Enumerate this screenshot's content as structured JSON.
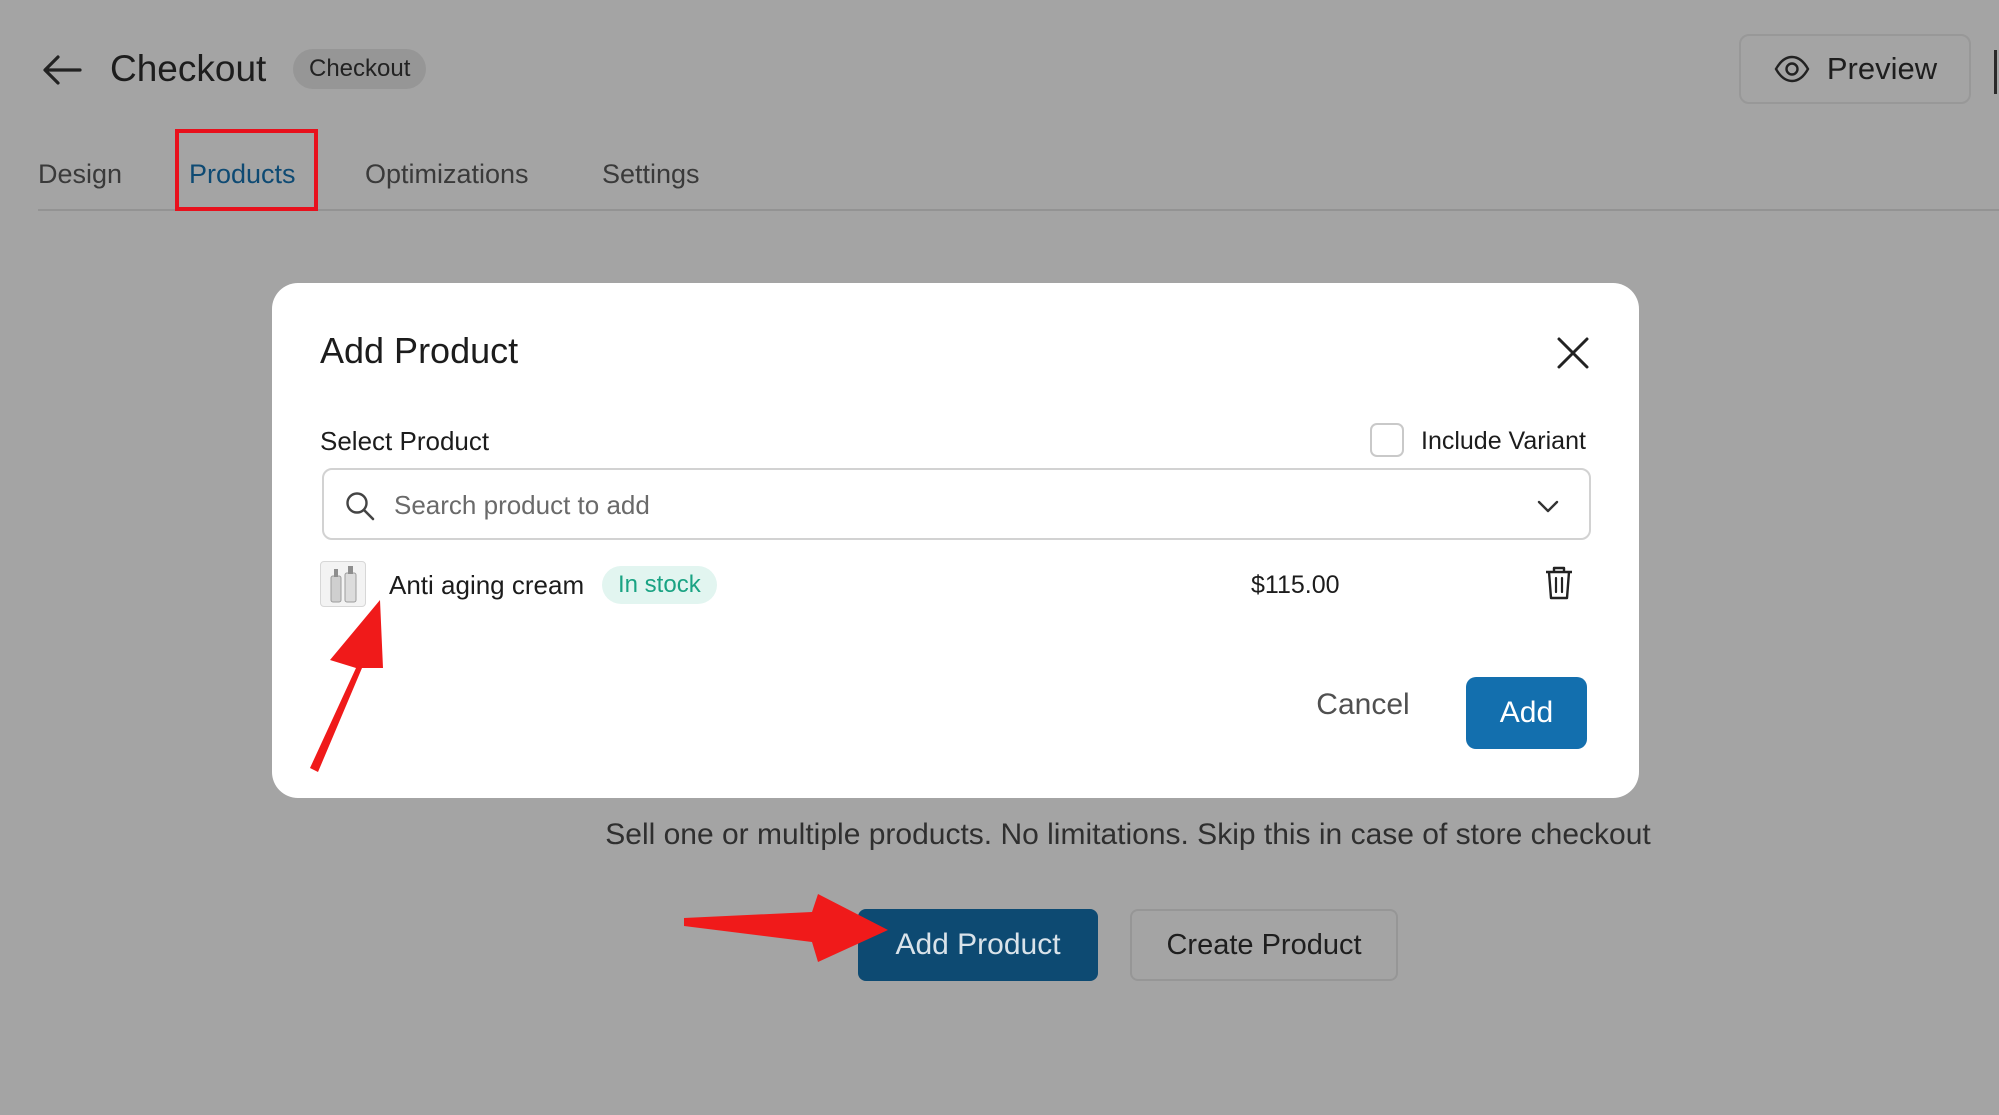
{
  "header": {
    "title": "Checkout",
    "badge": "Checkout",
    "preview_label": "Preview"
  },
  "tabs": [
    {
      "label": "Design"
    },
    {
      "label": "Products"
    },
    {
      "label": "Optimizations"
    },
    {
      "label": "Settings"
    }
  ],
  "active_tab": "Products",
  "modal": {
    "title": "Add Product",
    "select_label": "Select Product",
    "include_variant_label": "Include Variant",
    "search_placeholder": "Search product to add",
    "product": {
      "name": "Anti aging cream",
      "stock_status": "In stock",
      "price": "$115.00"
    },
    "cancel_label": "Cancel",
    "add_label": "Add"
  },
  "background": {
    "description": "Sell one or multiple products. No limitations. Skip this in case of store checkout",
    "add_product_label": "Add Product",
    "create_product_label": "Create Product"
  },
  "colors": {
    "overlay_bg": "#a4a4a4",
    "accent": "#136fae",
    "annotation_red": "#e8101c",
    "stock_green": "#1aa383"
  }
}
